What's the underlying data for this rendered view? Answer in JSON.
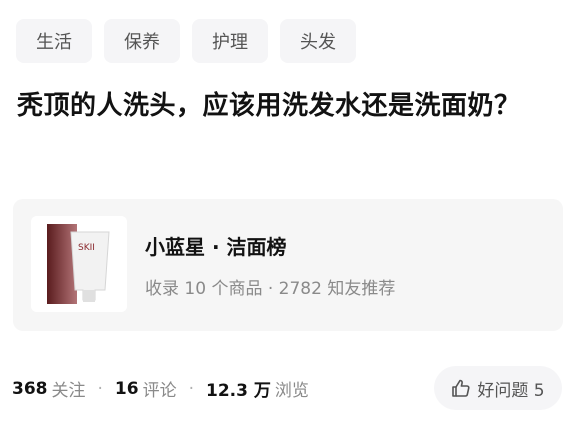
{
  "tags": [
    "生活",
    "保养",
    "护理",
    "头发"
  ],
  "question": {
    "title": "秃顶的人洗头，应该用洗发水还是洗面奶？"
  },
  "product_card": {
    "title": "小蓝星 · 洁面榜",
    "subtitle": "收录 10 个商品 · 2782 知友推荐",
    "thumb_brand_text": "SKII"
  },
  "stats": {
    "followers_count": "368",
    "followers_label": "关注",
    "comments_count": "16",
    "comments_label": "评论",
    "views_count": "12.3 万",
    "views_label": "浏览",
    "separator": "·"
  },
  "good_question": {
    "label": "好问题 5",
    "icon": "thumbs-up-icon"
  }
}
